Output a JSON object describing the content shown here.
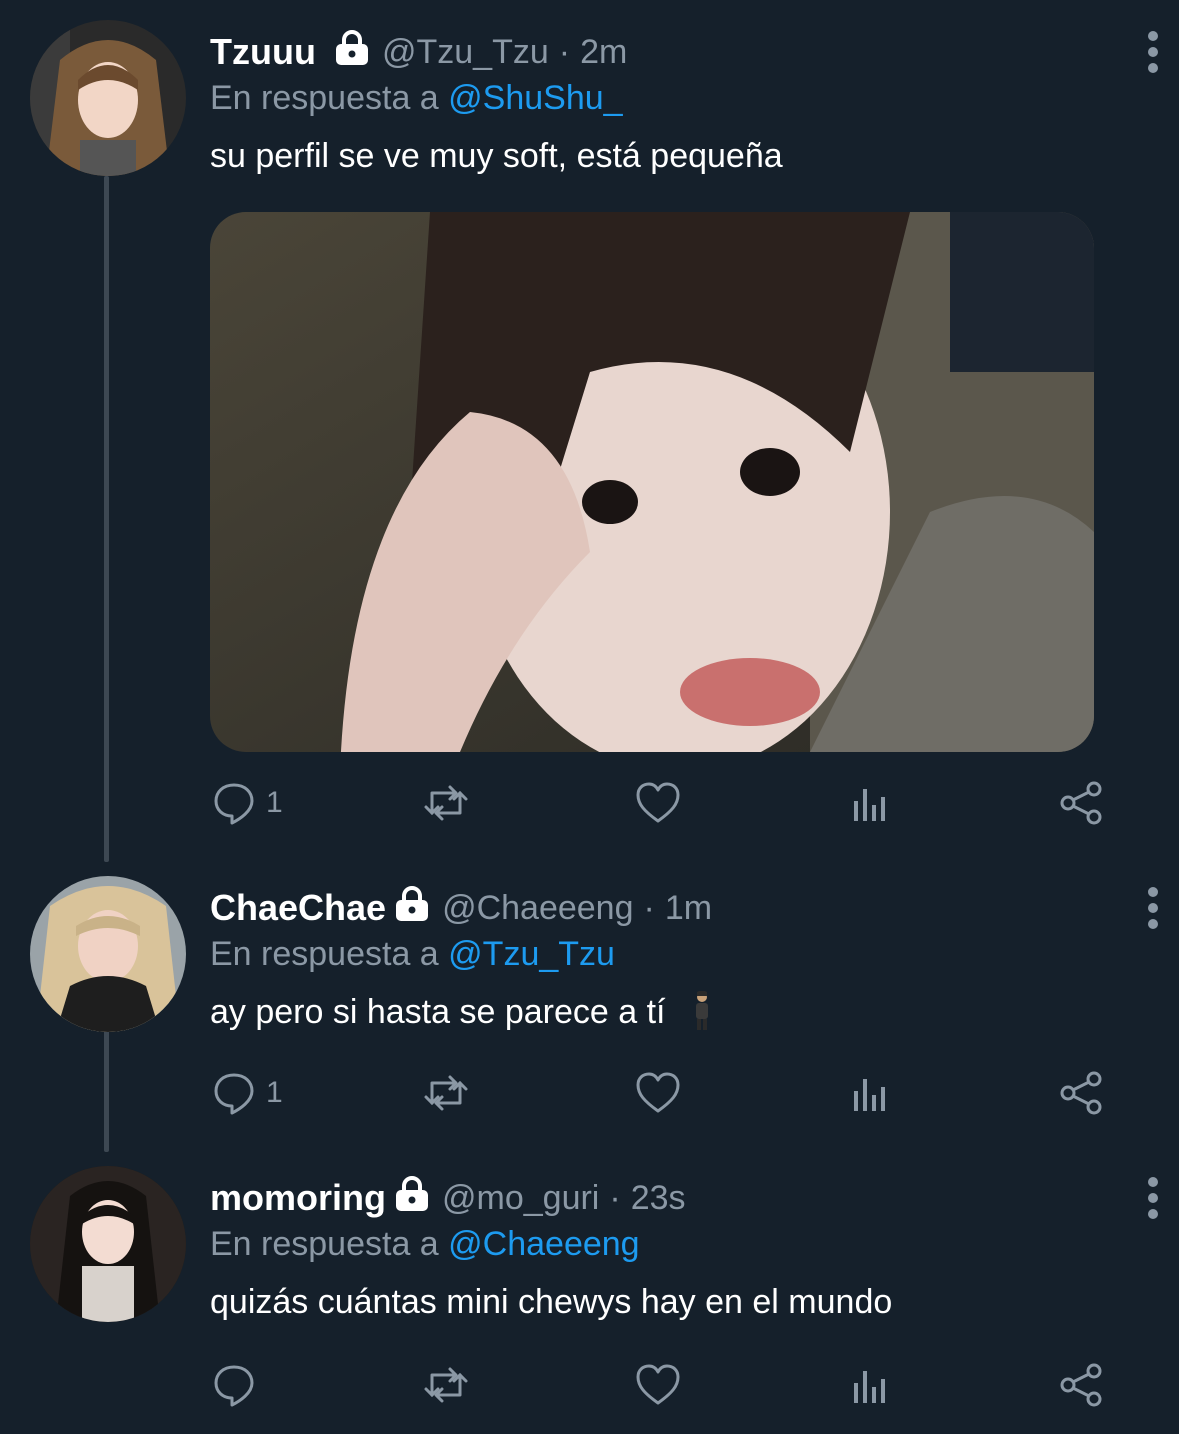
{
  "tweets": [
    {
      "display_name": "Tzuuu",
      "handle": "@Tzu_Tzu",
      "separator": "·",
      "time": "2m",
      "reply_prefix": "En respuesta a",
      "reply_to": "@ShuShu_",
      "text": "su perfil se ve muy soft, está pequeña",
      "reply_count": "1",
      "has_media": true
    },
    {
      "display_name": "ChaeChae",
      "handle": "@Chaeeeng",
      "separator": "·",
      "time": "1m",
      "reply_prefix": "En respuesta a",
      "reply_to": "@Tzu_Tzu",
      "text": "ay pero si hasta se parece a tí",
      "reply_count": "1",
      "has_media": false
    },
    {
      "display_name": "momoring",
      "handle": "@mo_guri",
      "separator": "·",
      "time": "23s",
      "reply_prefix": "En respuesta a",
      "reply_to": "@Chaeeeng",
      "text": "quizás cuántas mini chewys hay en el mundo",
      "reply_count": "",
      "has_media": false
    }
  ],
  "icons": {
    "lock": "lock-icon",
    "more": "more-vertical-icon",
    "reply": "reply-icon",
    "retweet": "retweet-icon",
    "like": "heart-icon",
    "views": "analytics-icon",
    "share": "share-icon",
    "emoji": "person-emoji-icon"
  },
  "colors": {
    "background": "#15202b",
    "muted": "#8b98a5",
    "accent": "#1d9bf0",
    "thread_line": "#3d4853"
  }
}
